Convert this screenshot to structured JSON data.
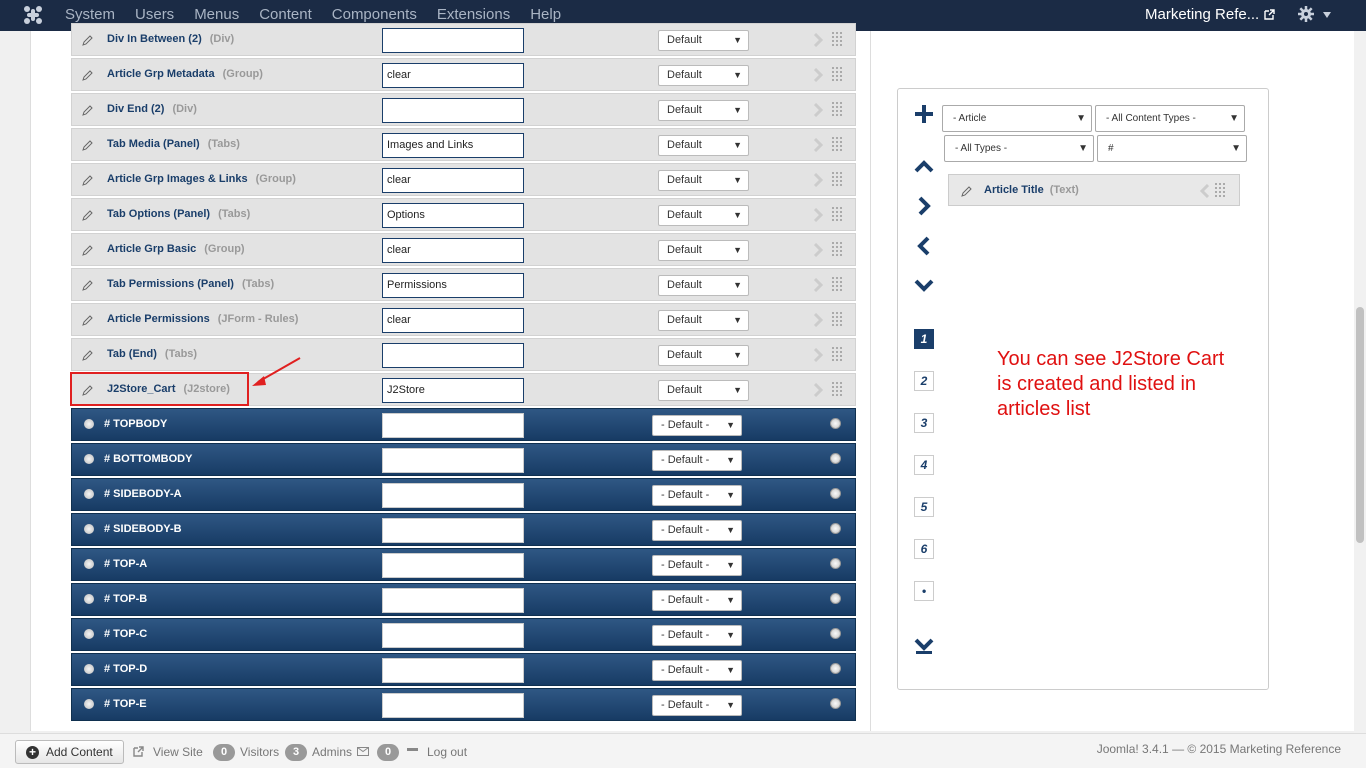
{
  "navbar": {
    "menu": [
      "System",
      "Users",
      "Menus",
      "Content",
      "Components",
      "Extensions",
      "Help"
    ],
    "site_name": "Marketing Refe..."
  },
  "rows_grey": [
    {
      "title": "Div In Between (2)",
      "type": "(Div)",
      "field": "",
      "select": "Default"
    },
    {
      "title": "Article Grp Metadata",
      "type": "(Group)",
      "field": "clear",
      "select": "Default"
    },
    {
      "title": "Div End (2)",
      "type": "(Div)",
      "field": "",
      "select": "Default"
    },
    {
      "title": "Tab Media (Panel)",
      "type": "(Tabs)",
      "field": "Images and Links",
      "select": "Default"
    },
    {
      "title": "Article Grp Images & Links",
      "type": "(Group)",
      "field": "clear",
      "select": "Default"
    },
    {
      "title": "Tab Options (Panel)",
      "type": "(Tabs)",
      "field": "Options",
      "select": "Default"
    },
    {
      "title": "Article Grp Basic",
      "type": "(Group)",
      "field": "clear",
      "select": "Default"
    },
    {
      "title": "Tab Permissions (Panel)",
      "type": "(Tabs)",
      "field": "Permissions",
      "select": "Default"
    },
    {
      "title": "Article Permissions",
      "type": "(JForm - Rules)",
      "field": "clear",
      "select": "Default"
    },
    {
      "title": "Tab (End)",
      "type": "(Tabs)",
      "field": "",
      "select": "Default"
    },
    {
      "title": "J2Store_Cart",
      "type": "(J2store)",
      "field": "J2Store",
      "select": "Default"
    }
  ],
  "rows_blue": [
    {
      "title": "# TOPBODY",
      "select": "- Default -"
    },
    {
      "title": "# BOTTOMBODY",
      "select": "- Default -"
    },
    {
      "title": "# SIDEBODY-A",
      "select": "- Default -"
    },
    {
      "title": "# SIDEBODY-B",
      "select": "- Default -"
    },
    {
      "title": "# TOP-A",
      "select": "- Default -"
    },
    {
      "title": "# TOP-B",
      "select": "- Default -"
    },
    {
      "title": "# TOP-C",
      "select": "- Default -"
    },
    {
      "title": "# TOP-D",
      "select": "- Default -"
    },
    {
      "title": "# TOP-E",
      "select": "- Default -"
    }
  ],
  "side": {
    "filters": [
      "- Article",
      "- All Content Types -",
      "- All Types -",
      "#"
    ],
    "chip_title": "Article Title",
    "chip_type": "(Text)",
    "pages": [
      "1",
      "2",
      "3",
      "4",
      "5",
      "6",
      "•"
    ],
    "note": "You can see J2Store Cart is created and listed in articles list"
  },
  "status": {
    "add_content": "Add Content",
    "view_site": "View Site",
    "visitors_count": "0",
    "visitors": "Visitors",
    "admins_count": "3",
    "admins": "Admins",
    "messages_count": "0",
    "logout": "Log out",
    "footer": "Joomla! 3.4.1  —  © 2015 Marketing Reference"
  },
  "colors": {
    "navbar": "#1b2b45",
    "accent": "#1a3e6a",
    "row_blue": "#173b64",
    "highlight": "#e02020"
  },
  "icons": [
    "joomla-logo-icon",
    "external-link-icon",
    "gear-icon",
    "pencil-icon",
    "chevron-right-icon",
    "grip-icon",
    "plus-icon",
    "arrow-up-icon",
    "arrow-right-icon",
    "arrow-left-icon",
    "arrow-down-icon",
    "arrow-down-end-icon"
  ]
}
